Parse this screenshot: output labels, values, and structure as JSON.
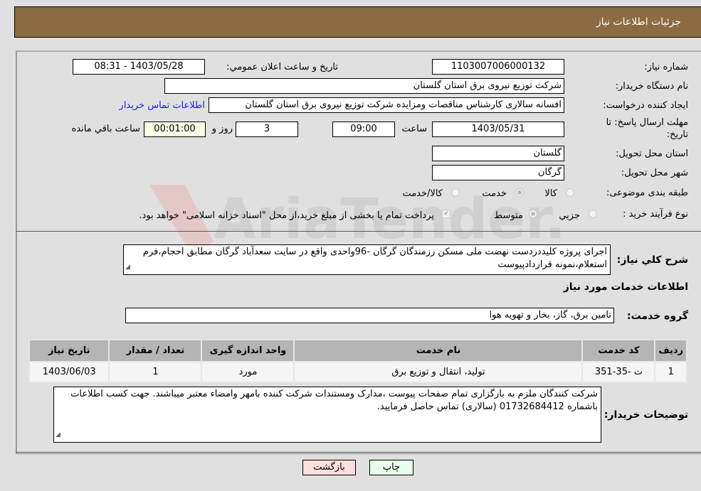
{
  "header": {
    "title": "جزئیات اطلاعات نیاز"
  },
  "form": {
    "need_number": {
      "label": "شماره نیاز:",
      "value": "1103007006000132"
    },
    "announce_datetime": {
      "label": "تاریخ و ساعت اعلان عمومي:",
      "value": "1403/05/28 - 08:31"
    },
    "buyer_org": {
      "label": "نام دستگاه خریدار:",
      "value": "شرکت توزیع نیروی برق استان گلستان"
    },
    "requester": {
      "label": "ایجاد کننده درخواست:",
      "value": "افسانه سالاری کارشناس مناقصات ومزایده شرکت توزیع نیروی برق استان گلستان",
      "contact_link": "اطلاعات تماس خریدار"
    },
    "deadline": {
      "label_line1": "مهلت ارسال پاسخ: تا",
      "label_line2": "تاریخ:",
      "date": "1403/05/31",
      "time_label": "ساعت",
      "time": "09:00",
      "days": "3",
      "days_label": "روز و",
      "remaining": "00:01:00",
      "remaining_label": "ساعت باقي مانده"
    },
    "province": {
      "label": "استان محل تحویل:",
      "value": "گلستان"
    },
    "city": {
      "label": "شهر محل تحویل:",
      "value": "گرگان"
    },
    "category": {
      "label": "طبقه بندی موضوعی:",
      "options": [
        {
          "label": "کالا",
          "checked": false
        },
        {
          "label": "خدمت",
          "checked": true
        },
        {
          "label": "کالا/خدمت",
          "checked": false
        }
      ]
    },
    "purchase_process": {
      "label": "نوع فرآیند خرید :",
      "options": [
        {
          "label": "جزيي",
          "checked": false
        },
        {
          "label": "متوسط",
          "checked": true
        }
      ],
      "treasury_note": "پرداخت تمام یا بخشی از مبلغ خرید،از محل \"اسناد خزانه اسلامی\" خواهد بود.",
      "treasury_checked": true
    }
  },
  "description": {
    "label": "شرح كلي نياز:",
    "text": "اجرای پروژه کلیددردست نهضت ملی مسکن رزمندگان گرگان -96واحدی واقع در سایت سعدآباد گرگان مطابق احجام،فرم استعلام،نمونه قراردادپیوست"
  },
  "services": {
    "section_title": "اطلاعات خدمات مورد نياز",
    "group_label": "گروه خدمت:",
    "group_value": "تامین برق، گاز، بخار و تهویه هوا",
    "table": {
      "headers": [
        "رديف",
        "کد خدمت",
        "نام خدمت",
        "واحد اندازه گیری",
        "تعداد / مقدار",
        "تاریخ نیاز"
      ],
      "rows": [
        [
          "1",
          "ت -35-351",
          "تولید، انتقال و توزیع برق",
          "مورد",
          "1",
          "1403/06/03"
        ]
      ]
    }
  },
  "buyer_notes": {
    "label": "توضيحات خريدار:",
    "text": "شرکت کنندگان ملزم به بارگزاری تمام صفحات پیوست ،مدارک ومستندات شرکت کننده بامهر وامضاء معتبر میباشند. جهت کسب اطلاعات باشماره 01732684412 (سالاری) تماس حاصل فرمایید."
  },
  "buttons": {
    "print": "چاپ",
    "back": "بازگشت"
  },
  "watermark": {
    "text": "AriaTender.net"
  }
}
